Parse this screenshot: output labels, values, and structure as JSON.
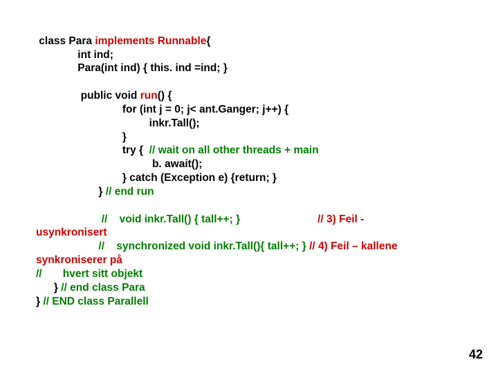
{
  "code": {
    "l1a": " class Para ",
    "l1b": "implements",
    "l1c": " ",
    "l1d": "Runnable",
    "l1e": "{",
    "l2": "              int ind;",
    "l3": "              Para(int ind) { this. ind =ind; }",
    "l5a": "               public void ",
    "l5b": "run",
    "l5c": "() {",
    "l6": "                             for (int j = 0; j< ant.Ganger; j++) {",
    "l7": "                                      inkr.Tall();",
    "l8": "                             }",
    "l9a": "                             try { ",
    "l9b": " // wait on all other threads + main",
    "l10": "                                       b. await();",
    "l11": "                             } catch (Exception e) {return; }",
    "l12a": "                     } ",
    "l12b": "// end run",
    "m1a": "                      //    void inkr.Tall() { tall++; }                          ",
    "m1b": "// 3) Feil -",
    "m1c": "usynkronisert",
    "m2a": "                     //    synchronized void inkr.Tall(){ tall++; } ",
    "m2b": "// 4) Feil – kallene",
    "m2c": "synkroniserer på",
    "m3a": "//       hvert sitt objekt",
    "m4a": "      } ",
    "m4b": "// end class Para",
    "m5a": "} ",
    "m5b": "// END class Parallell"
  },
  "page_number": "42"
}
